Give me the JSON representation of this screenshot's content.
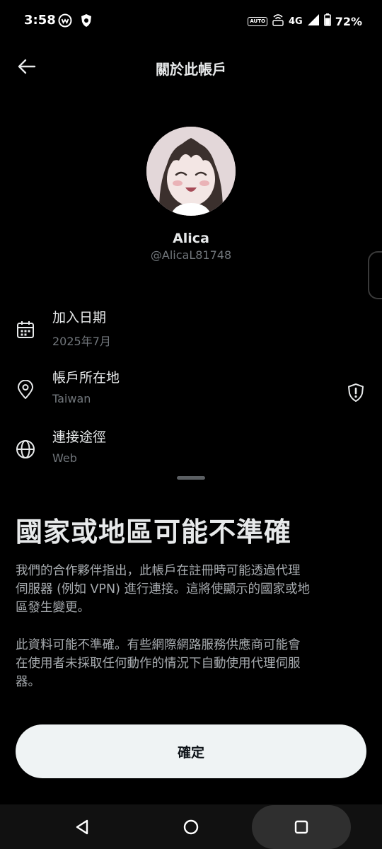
{
  "status_bar": {
    "time": "3:58",
    "app_icons": [
      "webtoon-icon",
      "shield-app-icon"
    ],
    "indicators": [
      "auto-icon",
      "vowifi-icon",
      "network-4g-icon",
      "signal-icon",
      "battery-icon"
    ],
    "network_label": "4G",
    "battery_percent": "72%"
  },
  "header": {
    "title": "關於此帳戶"
  },
  "profile": {
    "display_name": "Alica",
    "handle": "@AlicaL81748"
  },
  "info_rows": [
    {
      "icon": "calendar-icon",
      "label": "加入日期",
      "value": "2025年7月"
    },
    {
      "icon": "location-pin-icon",
      "label": "帳戶所在地",
      "value": "Taiwan"
    },
    {
      "icon": "globe-icon",
      "label": "連接途徑",
      "value": "Web"
    }
  ],
  "sheet": {
    "title": "國家或地區可能不準確",
    "paragraph_1_lines": [
      "我們的合作夥伴指出，此帳戶在註冊時可能透過代理",
      "伺服器 (例如 VPN) 進行連接。這將使顯示的國家或地",
      "區發生變更。"
    ],
    "paragraph_2_lines": [
      "此資料可能不準確。有些網際網路服務供應商可能會",
      "在使用者未採取任何動作的情況下自動使用代理伺服",
      "器。"
    ],
    "confirm_label": "確定"
  },
  "colors": {
    "background": "#000000",
    "primary_text": "#e7e9ea",
    "secondary_text": "#71767b",
    "button_bg": "#eff3f4",
    "button_text": "#0f1419"
  },
  "nav_bar": {
    "buttons": [
      "back-triangle-icon",
      "home-circle-icon",
      "recents-square-icon"
    ]
  }
}
